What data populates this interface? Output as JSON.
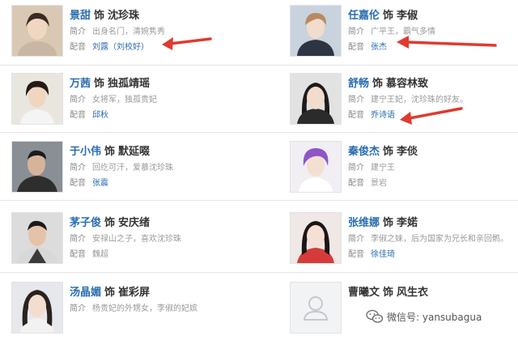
{
  "labels": {
    "shi": "饰",
    "intro": "简介",
    "voice": "配音"
  },
  "cast": [
    {
      "actor": "景甜",
      "role": "沈珍珠",
      "intro": "出身名门，清婉隽秀",
      "voice": "刘露（刘校好）",
      "voice_dim": false
    },
    {
      "actor": "任嘉伦",
      "role": "李俶",
      "intro": "广平王，霸气多情",
      "voice": "张杰",
      "voice_dim": false
    },
    {
      "actor": "万茜",
      "role": "独孤靖瑶",
      "intro": "女将军，独孤贵妃",
      "voice": "邱秋",
      "voice_dim": false
    },
    {
      "actor": "舒畅",
      "role": "慕容林致",
      "intro": "建宁王妃，沈珍珠的好友。",
      "voice": "乔诗语",
      "voice_dim": false
    },
    {
      "actor": "于小伟",
      "role": "默延啜",
      "intro": "回纥可汗，爱慕沈珍珠",
      "voice": "张震",
      "voice_dim": false
    },
    {
      "actor": "秦俊杰",
      "role": "李倓",
      "intro": "建宁王",
      "voice": "景岩",
      "voice_dim": true
    },
    {
      "actor": "茅子俊",
      "role": "安庆绪",
      "intro": "安禄山之子，喜欢沈珍珠",
      "voice": "魏超",
      "voice_dim": true
    },
    {
      "actor": "张维娜",
      "role": "李婼",
      "intro": "李俶之妹，后为国家为兄长和亲回鹘。",
      "voice": "徐佳琦",
      "voice_dim": false
    },
    {
      "actor": "汤晶媚",
      "role": "崔彩屏",
      "intro": "杨贵妃的外甥女，李俶的妃嫔",
      "voice": "",
      "voice_dim": false
    },
    {
      "actor": "曹曦文",
      "role": "风生衣",
      "intro": "",
      "voice": "",
      "voice_dim": false
    }
  ],
  "annotation_color": "#e03a2f",
  "link_color": "#2a6db0",
  "watermark": {
    "icon": "wechat-icon",
    "text": "微信号: yansubagua"
  }
}
